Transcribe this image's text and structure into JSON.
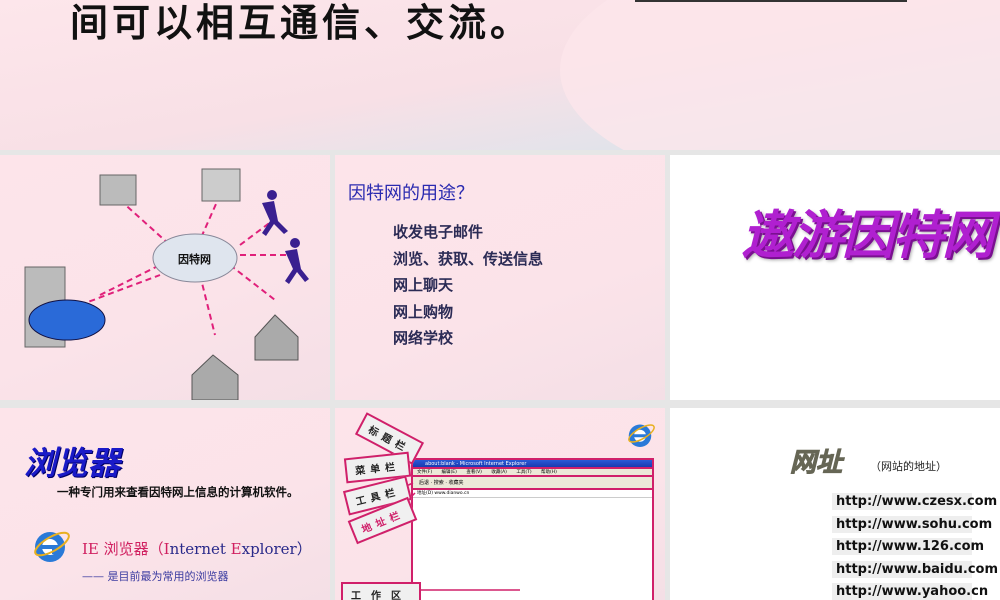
{
  "top_slide": {
    "title": "间可以相互通信、交流。"
  },
  "network_slide": {
    "cloud_label": "因特网"
  },
  "uses_slide": {
    "title": "因特网的用途？",
    "items": [
      "收发电子邮件",
      "浏览、获取、传送信息",
      "网上聊天",
      "网上购物",
      "网络学校"
    ]
  },
  "title_slide": {
    "title": "遨游因特网"
  },
  "browser_slide": {
    "title": "浏览器",
    "description": "一种专门用来查看因特网上信息的计算机软件。",
    "ie_prefix": "IE 浏览器（",
    "ie_I": "I",
    "ie_nternet": "nternet ",
    "ie_E": "E",
    "ie_xplorer": "xplorer）",
    "subtitle": "—— 是目前最为常用的浏览器"
  },
  "ie_slide": {
    "labels": {
      "title_bar": "标题栏",
      "menu_bar": "菜单栏",
      "tool_bar": "工具栏",
      "address_bar": "地址栏",
      "work_area": "工作区"
    },
    "window_title": "about:blank - Microsoft Internet Explorer",
    "menu": "文件(F) 编辑(E) 查看(V) 收藏(A) 工具(T) 帮助(H)",
    "toolbar": "后退 · 搜索 · 收藏夹",
    "address": "地址(D)  www.dianwo.cn"
  },
  "url_slide": {
    "title": "网址",
    "subtitle": "（网站的地址）",
    "urls": [
      "http://www.czesx.com",
      "http://www.sohu.com",
      "http://www.126.com",
      "http://www.baidu.com",
      "http://www.yahoo.cn"
    ]
  },
  "colors": {
    "accent_pink": "#d0206a",
    "blue_title": "#1a1ac8",
    "purple": "#b020d0"
  }
}
